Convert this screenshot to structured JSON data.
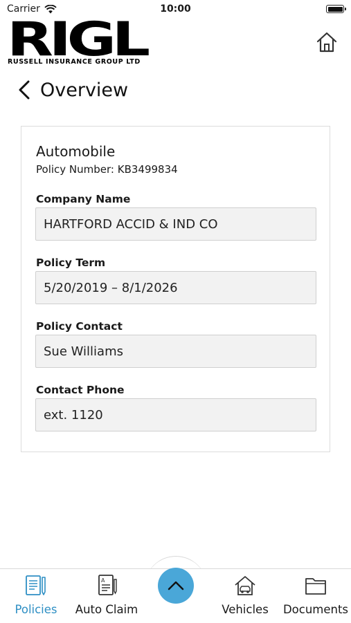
{
  "status_bar": {
    "carrier": "Carrier",
    "time": "10:00"
  },
  "header": {
    "logo_text": "RIGL",
    "logo_subtitle": "RUSSELL INSURANCE GROUP LTD"
  },
  "page": {
    "title": "Overview"
  },
  "policy": {
    "type": "Automobile",
    "number_text": "Policy Number: KB3499834",
    "fields": [
      {
        "label": "Company Name",
        "value": "HARTFORD ACCID & IND CO"
      },
      {
        "label": "Policy Term",
        "value": "5/20/2019 – 8/1/2026"
      },
      {
        "label": "Policy Contact",
        "value": "Sue Williams"
      },
      {
        "label": "Contact Phone",
        "value": "ext. 1120"
      }
    ]
  },
  "tabs": [
    {
      "label": "Policies",
      "icon": "policies-icon",
      "active": true
    },
    {
      "label": "Auto Claim",
      "icon": "auto-claim-icon",
      "active": false
    },
    {
      "label": "Vehicles",
      "icon": "vehicles-icon",
      "active": false
    },
    {
      "label": "Documents",
      "icon": "documents-icon",
      "active": false
    }
  ],
  "colors": {
    "accent": "#2e8fc4",
    "fab": "#4aa7d8",
    "field_bg": "#f2f2f2"
  }
}
